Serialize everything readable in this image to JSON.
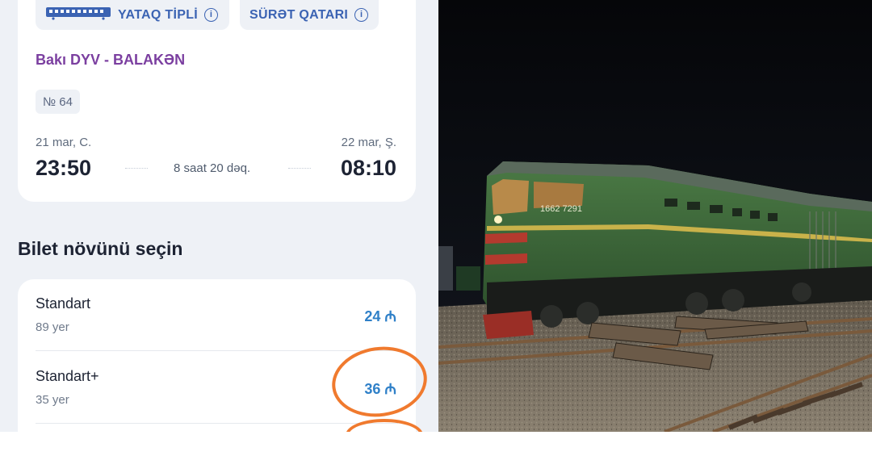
{
  "train_card": {
    "chip_sleeper": "YATAQ TİPLİ",
    "chip_express": "SÜRƏT QATARI",
    "info_glyph": "i",
    "route": "Bakı DYV - BALAKƏN",
    "train_number": "№ 64",
    "departure": {
      "date": "21 mar, C.",
      "time": "23:50"
    },
    "arrival": {
      "date": "22 mar, Ş.",
      "time": "08:10"
    },
    "duration": "8 saat 20 dəq."
  },
  "ticket_section": {
    "title": "Bilet növünü seçin",
    "options": [
      {
        "name": "Standart",
        "seats": "89 yer",
        "price": "24 ₼"
      },
      {
        "name": "Standart+",
        "seats": "35 yer",
        "price": "36 ₼"
      }
    ]
  },
  "photo": {
    "locomotive_number": "1662 7291"
  },
  "colors": {
    "accent_blue": "#2f80c8",
    "route_purple": "#7b3fa0",
    "annotation_orange": "#f07a2e",
    "locomotive_green": "#3d6b3a"
  },
  "icons": [
    "train-icon",
    "info-icon"
  ]
}
